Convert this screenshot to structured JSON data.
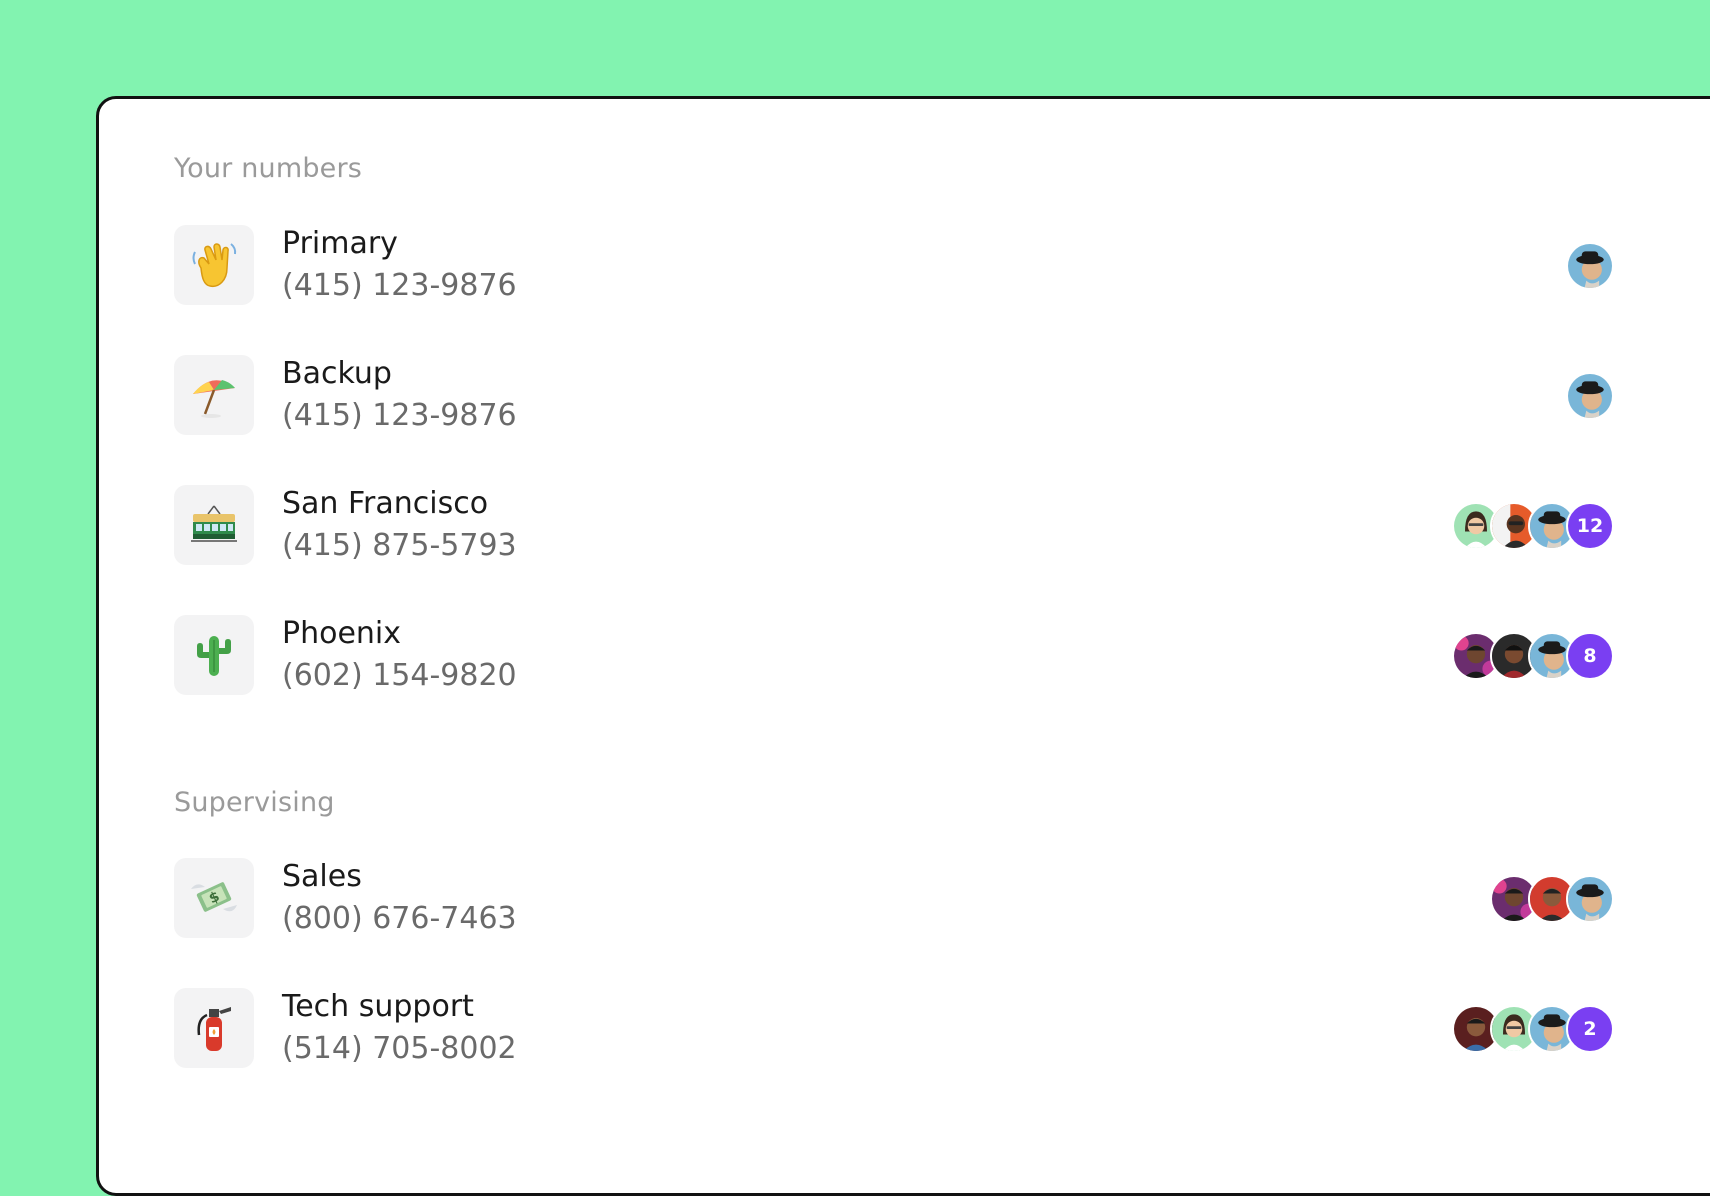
{
  "sections": {
    "your_numbers": {
      "label": "Your numbers"
    },
    "supervising": {
      "label": "Supervising"
    }
  },
  "rows": [
    {
      "name": "Primary",
      "phone": "(415) 123-9876",
      "icon": "waving-hand-icon",
      "members": [
        "avatar-man-hat"
      ],
      "extra_count": null
    },
    {
      "name": "Backup",
      "phone": "(415) 123-9876",
      "icon": "umbrella-icon",
      "members": [
        "avatar-man-hat"
      ],
      "extra_count": null
    },
    {
      "name": "San Francisco",
      "phone": "(415) 875-5793",
      "icon": "tram-icon",
      "members": [
        "avatar-woman-green",
        "avatar-man-orange",
        "avatar-man-hat"
      ],
      "extra_count": "12"
    },
    {
      "name": "Phoenix",
      "phone": "(602) 154-9820",
      "icon": "cactus-icon",
      "members": [
        "avatar-man-pink",
        "avatar-man-dark",
        "avatar-man-hat"
      ],
      "extra_count": "8"
    },
    {
      "name": "Sales",
      "phone": "(800) 676-7463",
      "icon": "money-wings-icon",
      "members": [
        "avatar-man-pink",
        "avatar-man-red",
        "avatar-man-hat"
      ],
      "extra_count": null
    },
    {
      "name": "Tech support",
      "phone": "(514) 705-8002",
      "icon": "fire-extinguisher-icon",
      "members": [
        "avatar-man-dark-red",
        "avatar-woman-green",
        "avatar-man-hat"
      ],
      "extra_count": "2"
    }
  ],
  "colors": {
    "background": "#82f3b0",
    "count_badge": "#7a3ff2",
    "section_label": "#9a9a9a"
  }
}
